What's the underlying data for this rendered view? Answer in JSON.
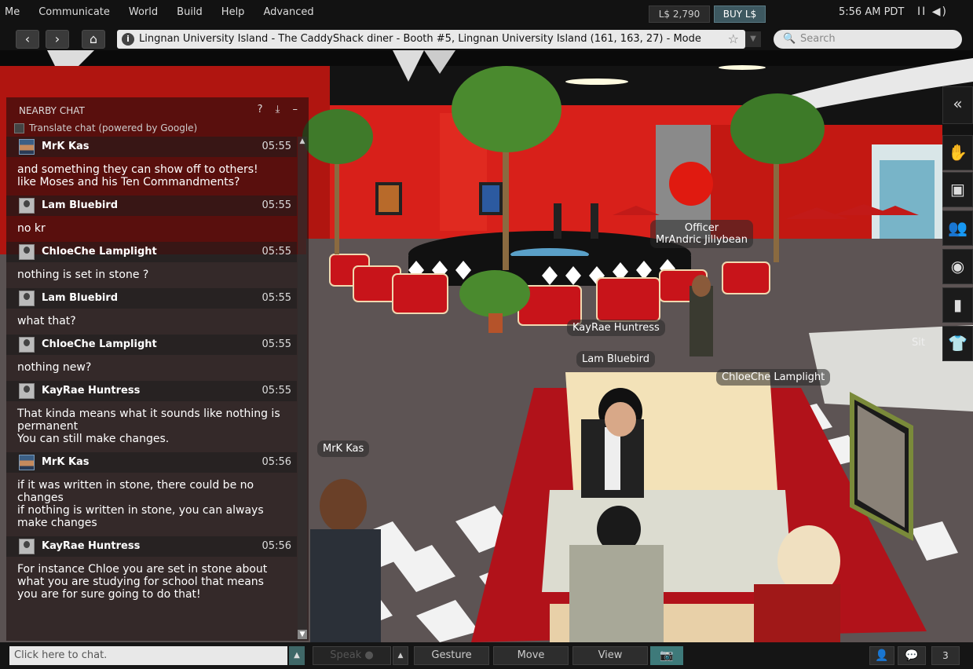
{
  "menu": [
    "Me",
    "Communicate",
    "World",
    "Build",
    "Help",
    "Advanced"
  ],
  "balance": "L$ 2,790",
  "buy_label": "BUY L$",
  "clock": "5:56 AM PDT",
  "media_icons": "II ◀)",
  "nav": {
    "back": "‹",
    "forward": "›",
    "home": "⌂",
    "location": "Lingnan University Island - The CaddyShack diner - Booth #5, Lingnan University Island (161, 163, 27) - Mode",
    "search_placeholder": "Search"
  },
  "scene": {
    "tags": {
      "officer_line1": "Officer",
      "officer_line2": "MrAndric Jillybean",
      "kayrae": "KayRae Huntress",
      "lam": "Lam Bluebird",
      "chloe": "ChloeChe Lamplight",
      "mrk": "MrK Kas",
      "sit": "Sit"
    }
  },
  "right_toolbar": [
    "«",
    "✋",
    "▣",
    "👥",
    "◉",
    "▮",
    "👕"
  ],
  "chat": {
    "title": "NEARBY CHAT",
    "tools": "? ⤓ –",
    "translate_label": "Translate chat (powered by Google)",
    "messages": [
      {
        "name": "MrK Kas",
        "time": "05:55",
        "lines": [
          "and something they can show off to others!",
          "like Moses and his Ten Commandments?"
        ]
      },
      {
        "name": "Lam Bluebird",
        "time": "05:55",
        "lines": [
          "no kr"
        ]
      },
      {
        "name": "ChloeChe Lamplight",
        "time": "05:55",
        "lines": [
          "nothing is set in stone ?"
        ]
      },
      {
        "name": "Lam Bluebird",
        "time": "05:55",
        "lines": [
          "what that?"
        ]
      },
      {
        "name": "ChloeChe Lamplight",
        "time": "05:55",
        "lines": [
          "nothing new?"
        ]
      },
      {
        "name": "KayRae Huntress",
        "time": "05:55",
        "lines": [
          "That kinda means what it sounds like nothing is",
          "permanent",
          "You can still make changes."
        ]
      },
      {
        "name": "MrK Kas",
        "time": "05:56",
        "lines": [
          "if it was written in stone, there could be no",
          "changes",
          "if nothing is written in stone, you can always",
          "make changes"
        ]
      },
      {
        "name": "KayRae Huntress",
        "time": "05:56",
        "lines": [
          "For instance Chloe you are set in stone about",
          "what you are studying for school that means",
          "you are for sure going to do that!"
        ]
      }
    ]
  },
  "bottom": {
    "chat_placeholder": "Click here to chat.",
    "speak": "Speak",
    "gesture": "Gesture",
    "move": "Move",
    "view": "View",
    "notifications": "3"
  }
}
